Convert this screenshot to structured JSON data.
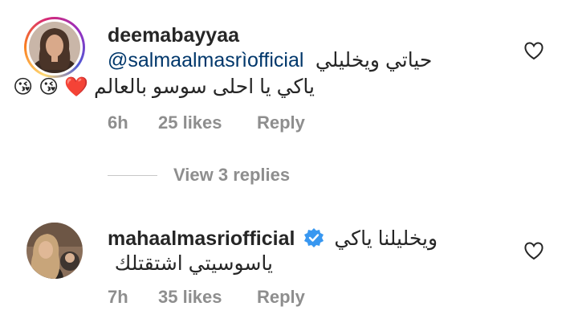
{
  "comments": [
    {
      "username": "deemabayyaa",
      "mention": "@salmaalmasrìofficial",
      "text_line1": "حياتي ويخليلي",
      "text_line2": "ياكي يا احلى سوسو بالعالم",
      "emojis": [
        "😘",
        "😘",
        "❤️"
      ],
      "time": "6h",
      "likes": "25 likes",
      "reply_label": "Reply"
    },
    {
      "username": "mahaalmasriofficial",
      "text_line1": "ويخليلنا ياكي",
      "text_line2": "ياسوسيتي اشتقتلك",
      "time": "7h",
      "likes": "35 likes",
      "reply_label": "Reply"
    }
  ],
  "view_replies_label": "View 3 replies",
  "colors": {
    "text": "#262626",
    "muted": "#8e8e8e",
    "mention": "#00376b",
    "verified": "#3897f0"
  }
}
